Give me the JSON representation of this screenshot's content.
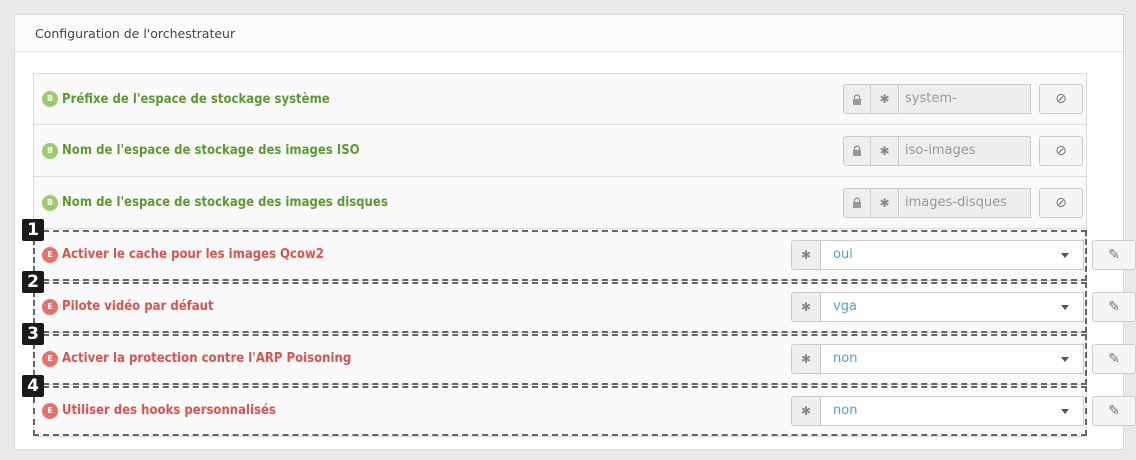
{
  "panel": {
    "title": "Configuration de l'orchestrateur"
  },
  "basic_badge": "B",
  "expert_badge": "E",
  "basic_rows": [
    {
      "label": "Préfixe de l'espace de stockage système",
      "value": "system-"
    },
    {
      "label": "Nom de l'espace de stockage des images ISO",
      "value": "iso-images"
    },
    {
      "label": "Nom de l'espace de stockage des images disques",
      "value": "images-disques"
    }
  ],
  "expert_rows": [
    {
      "number": "1",
      "label": "Activer le cache pour les images Qcow2",
      "value": "oui"
    },
    {
      "number": "2",
      "label": "Pilote vidéo par défaut",
      "value": "vga"
    },
    {
      "number": "3",
      "label": "Activer la protection contre l'ARP Poisoning",
      "value": "non"
    },
    {
      "number": "4",
      "label": "Utiliser des hooks personnalisés",
      "value": "non"
    }
  ],
  "icons": {
    "lock": "lock-icon",
    "required": "asterisk-icon",
    "reset": "ban-icon",
    "edit": "edit-icon",
    "dropdown": "caret-down-icon"
  },
  "colors": {
    "basic_label": "#5b9b2f",
    "expert_label": "#d9534f",
    "select_value": "#5b9bd5"
  }
}
